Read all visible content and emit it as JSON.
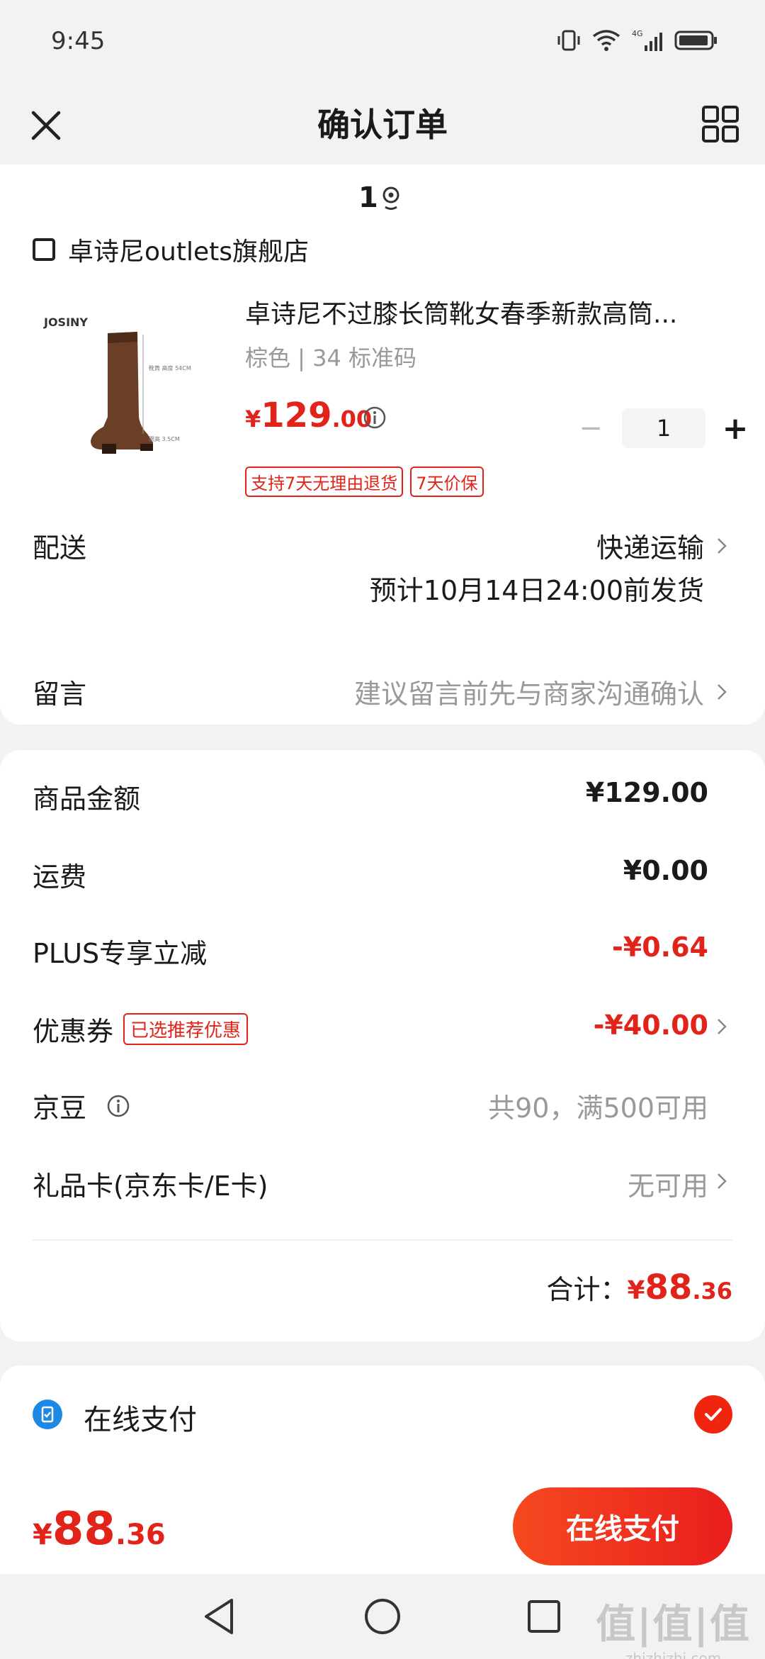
{
  "status_bar": {
    "time": "9:45",
    "network": "4G"
  },
  "nav": {
    "title": "确认订单"
  },
  "address": {
    "number": "1"
  },
  "shop": {
    "name": "卓诗尼outlets旗舰店"
  },
  "product": {
    "brand": "JOSINY",
    "title": "卓诗尼不过膝长筒靴女春季新款高筒...",
    "spec": "棕色 | 34 标准码",
    "price_symbol": "¥",
    "price_int": "129",
    "price_dec": ".00",
    "quantity": "1",
    "tags": [
      "支持7天无理由退货",
      "7天价保"
    ],
    "img_label_1": "靴筒 高度 54CM",
    "img_label_2": "跟高 3.5CM"
  },
  "delivery": {
    "label": "配送",
    "method": "快递运输",
    "estimate": "预计10月14日24:00前发货"
  },
  "message": {
    "label": "留言",
    "placeholder": "建议留言前先与商家沟通确认"
  },
  "summary": {
    "goods_label": "商品金额",
    "goods_value": "¥129.00",
    "freight_label": "运费",
    "freight_value": "¥0.00",
    "plus_label": "PLUS专享立减",
    "plus_value": "-¥0.64",
    "coupon_label": "优惠券",
    "coupon_tag": "已选推荐优惠",
    "coupon_value": "-¥40.00",
    "jingdou_label": "京豆",
    "jingdou_value": "共90，满500可用",
    "giftcard_label": "礼品卡(京东卡/E卡)",
    "giftcard_value": "无可用",
    "total_label": "合计：",
    "total_symbol": "¥",
    "total_int": "88",
    "total_dec": ".36"
  },
  "payment": {
    "method_label": "在线支付",
    "selected": true
  },
  "bottom": {
    "price_symbol": "¥",
    "price_int": "88",
    "price_dec": ".36",
    "button_label": "在线支付"
  },
  "watermark": {
    "main": "值|值|值",
    "sub": "zhizhizhi.com"
  },
  "colors": {
    "accent": "#e2231a",
    "pay_blue": "#1e88e5"
  }
}
